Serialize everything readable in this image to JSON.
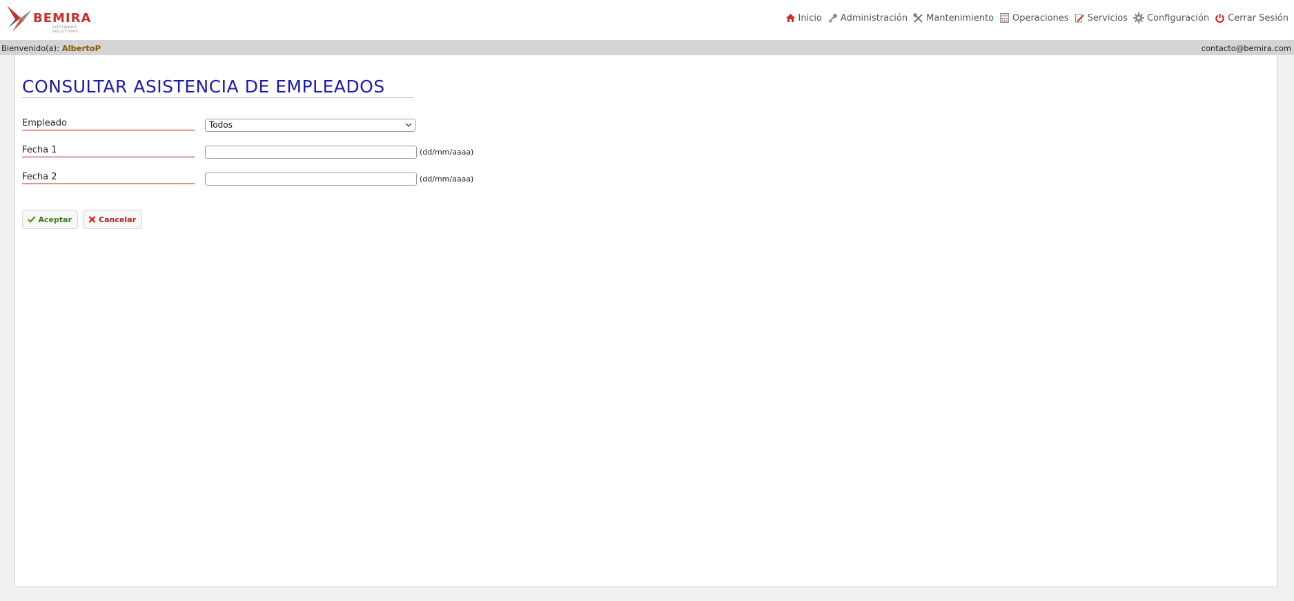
{
  "brand": {
    "name": "BEMIRA",
    "tagline": "SOFTWARE SOLUTIONS"
  },
  "nav": {
    "items": [
      {
        "label": "Inicio",
        "icon": "home-icon"
      },
      {
        "label": "Administración",
        "icon": "key-icon"
      },
      {
        "label": "Mantenimiento",
        "icon": "tools-icon"
      },
      {
        "label": "Operaciones",
        "icon": "calculator-icon"
      },
      {
        "label": "Servicios",
        "icon": "edit-doc-icon"
      },
      {
        "label": "Configuración",
        "icon": "gear-icon"
      },
      {
        "label": "Cerrar Sesión",
        "icon": "power-icon"
      }
    ]
  },
  "welcome": {
    "prefix": "Bienvenido(a):",
    "user": "AlbertoP",
    "contact": "contacto@bemira.com"
  },
  "page": {
    "title": "CONSULTAR ASISTENCIA DE EMPLEADOS"
  },
  "form": {
    "empleado_label": "Empleado",
    "empleado_value": "Todos",
    "fecha1_label": "Fecha 1",
    "fecha1_value": "",
    "fecha2_label": "Fecha 2",
    "fecha2_value": "",
    "date_hint": "(dd/mm/aaaa)"
  },
  "buttons": {
    "accept": "Aceptar",
    "cancel": "Cancelar"
  },
  "colors": {
    "title": "#1a1ab8",
    "label_underline": "#c00000",
    "brand": "#c9302c",
    "accept": "#3c7a18",
    "cancel": "#b01c1c"
  }
}
